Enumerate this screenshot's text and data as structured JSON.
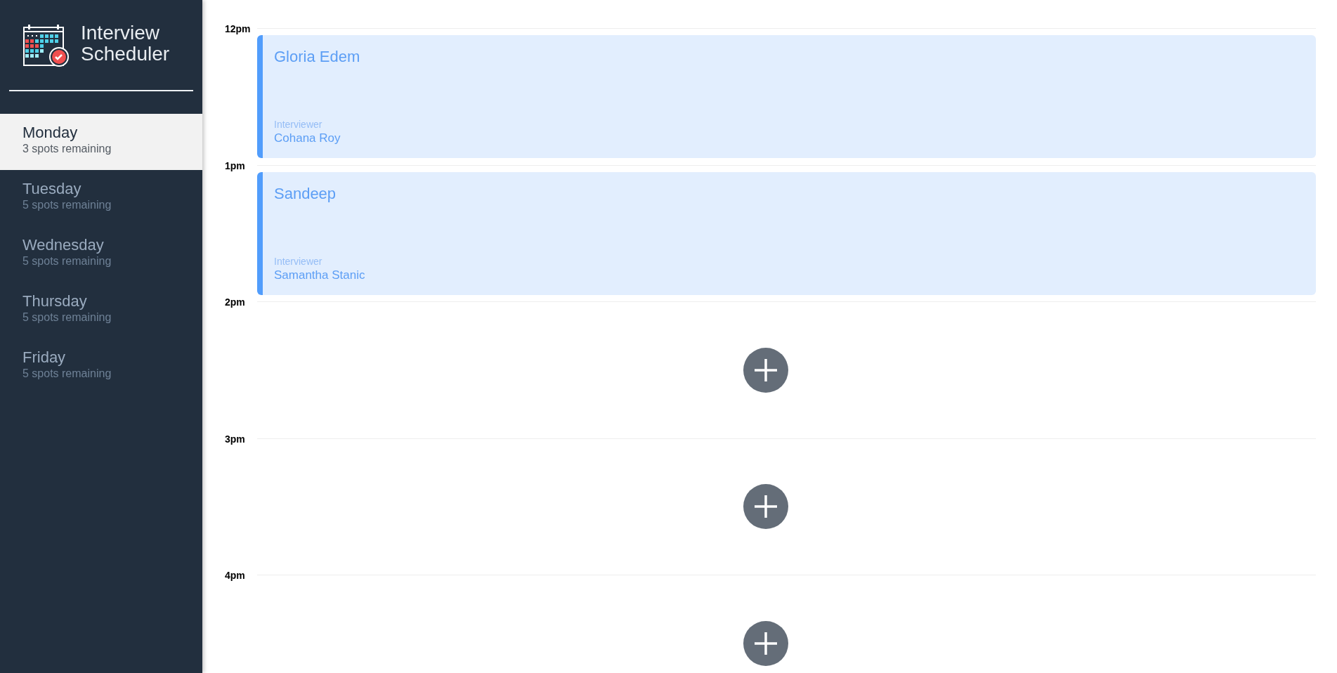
{
  "sidebar": {
    "title": "Interview Scheduler",
    "days": [
      {
        "name": "Monday",
        "spots": "3 spots remaining",
        "selected": true
      },
      {
        "name": "Tuesday",
        "spots": "5 spots remaining",
        "selected": false
      },
      {
        "name": "Wednesday",
        "spots": "5 spots remaining",
        "selected": false
      },
      {
        "name": "Thursday",
        "spots": "5 spots remaining",
        "selected": false
      },
      {
        "name": "Friday",
        "spots": "5 spots remaining",
        "selected": false
      }
    ]
  },
  "schedule": [
    {
      "time": "12pm",
      "kind": "appointment",
      "student": "Gloria Edem",
      "interviewer_label": "Interviewer",
      "interviewer": "Cohana Roy"
    },
    {
      "time": "1pm",
      "kind": "appointment",
      "student": "Sandeep",
      "interviewer_label": "Interviewer",
      "interviewer": "Samantha Stanic"
    },
    {
      "time": "2pm",
      "kind": "empty"
    },
    {
      "time": "3pm",
      "kind": "empty"
    },
    {
      "time": "4pm",
      "kind": "empty"
    }
  ]
}
